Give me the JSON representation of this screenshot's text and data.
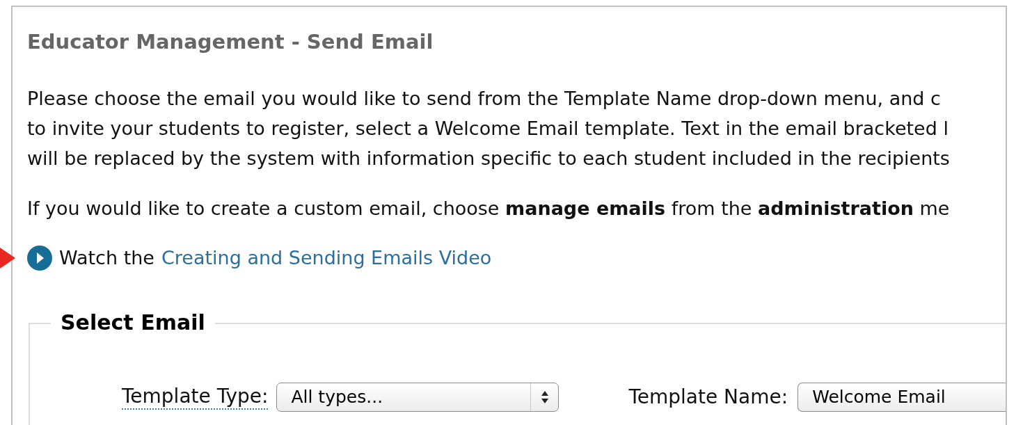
{
  "title": "Educator Management - Send Email",
  "intro_lines": [
    "Please choose the email you would like to send from the Template Name drop-down menu, and c",
    "to invite your students to register, select a Welcome Email template. Text in the email bracketed l",
    "will be replaced by the system with information specific to each student included in the recipients"
  ],
  "custom_line": "If you would like to create a custom email, choose **manage emails** from the **administration** me",
  "video": {
    "prefix": "Watch the",
    "link": "Creating and Sending Emails Video"
  },
  "fieldset": {
    "legend": "Select Email",
    "fields": [
      {
        "label": "Template Type:",
        "value": "All types...",
        "underlined": true,
        "stepper": true
      },
      {
        "label": "Template Name:",
        "value": "Welcome Email",
        "underlined": false,
        "stepper": false
      }
    ]
  }
}
